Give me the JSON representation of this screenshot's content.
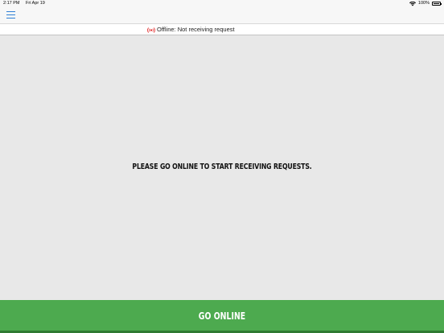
{
  "status_bar": {
    "time": "2:17 PM",
    "date": "Fri Apr 19",
    "battery_text": "100%",
    "wifi_icon": "wifi-icon",
    "battery_icon": "battery-full-icon"
  },
  "nav": {
    "menu_icon": "hamburger-menu-icon",
    "accent_color": "#2f7fd6"
  },
  "offline_banner": {
    "icon": "broadcast-offline-icon",
    "icon_color": "#e02020",
    "text": "Offline: Not receiving request"
  },
  "main": {
    "message": "PLEASE GO ONLINE TO START RECEIVING REQUESTS.",
    "background_color": "#e8e8e8"
  },
  "go_online_button": {
    "label": "GO ONLINE",
    "color": "#4daa4f"
  }
}
